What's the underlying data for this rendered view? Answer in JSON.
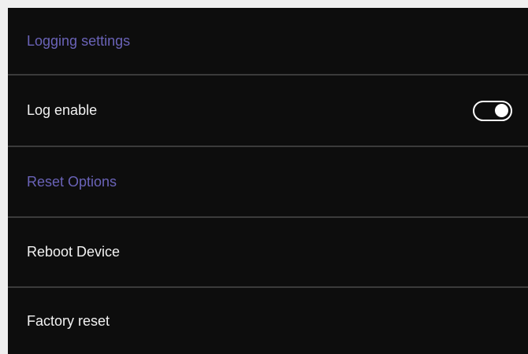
{
  "logging": {
    "section_title": "Logging settings",
    "log_enable_label": "Log enable",
    "log_enable_state": true
  },
  "reset": {
    "section_title": "Reset Options",
    "reboot_label": "Reboot Device",
    "factory_reset_label": "Factory reset"
  },
  "colors": {
    "background": "#0d0d0d",
    "section_header": "#6a63b8",
    "item_text": "#f2f2f2",
    "divider": "#3b3b3b",
    "outer_frame": "#efefef"
  }
}
